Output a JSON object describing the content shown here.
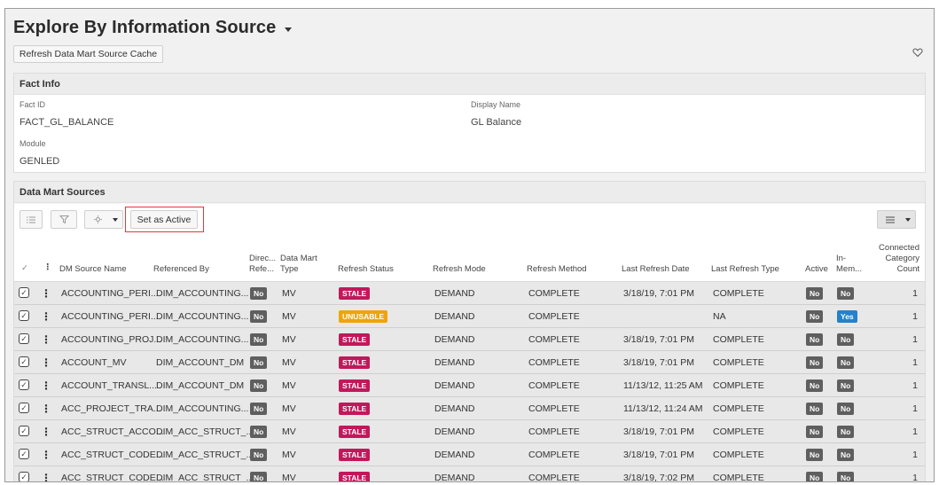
{
  "header": {
    "title": "Explore By Information Source",
    "refresh_button": "Refresh Data Mart Source Cache"
  },
  "fact_info": {
    "heading": "Fact Info",
    "fact_id_label": "Fact ID",
    "fact_id_value": "FACT_GL_BALANCE",
    "display_name_label": "Display Name",
    "display_name_value": "GL Balance",
    "module_label": "Module",
    "module_value": "GENLED"
  },
  "data_mart_sources": {
    "heading": "Data Mart Sources",
    "set_active_button": "Set as Active",
    "columns": {
      "dm_source_name": "DM Source Name",
      "referenced_by": "Referenced By",
      "direct_ref_1": "Direc...",
      "direct_ref_2": "Refe...",
      "dm_type_1": "Data Mart",
      "dm_type_2": "Type",
      "refresh_status": "Refresh Status",
      "refresh_mode": "Refresh Mode",
      "refresh_method": "Refresh Method",
      "last_refresh_date": "Last Refresh Date",
      "last_refresh_type": "Last Refresh Type",
      "active": "Active",
      "in_mem_1": "In-",
      "in_mem_2": "Mem...",
      "conn_1": "Connected",
      "conn_2": "Category",
      "conn_3": "Count"
    },
    "rows": [
      {
        "name": "ACCOUNTING_PERI...",
        "ref": "DIM_ACCOUNTING...",
        "direct": "No",
        "type": "MV",
        "status": "STALE",
        "mode": "DEMAND",
        "method": "COMPLETE",
        "date": "3/18/19, 7:01 PM",
        "ltype": "COMPLETE",
        "active": "No",
        "inmem": "No",
        "count": "1"
      },
      {
        "name": "ACCOUNTING_PERI...",
        "ref": "DIM_ACCOUNTING...",
        "direct": "No",
        "type": "MV",
        "status": "UNUSABLE",
        "mode": "DEMAND",
        "method": "COMPLETE",
        "date": "",
        "ltype": "NA",
        "active": "No",
        "inmem": "Yes",
        "count": "1"
      },
      {
        "name": "ACCOUNTING_PROJ...",
        "ref": "DIM_ACCOUNTING...",
        "direct": "No",
        "type": "MV",
        "status": "STALE",
        "mode": "DEMAND",
        "method": "COMPLETE",
        "date": "3/18/19, 7:01 PM",
        "ltype": "COMPLETE",
        "active": "No",
        "inmem": "No",
        "count": "1"
      },
      {
        "name": "ACCOUNT_MV",
        "ref": "DIM_ACCOUNT_DM",
        "direct": "No",
        "type": "MV",
        "status": "STALE",
        "mode": "DEMAND",
        "method": "COMPLETE",
        "date": "3/18/19, 7:01 PM",
        "ltype": "COMPLETE",
        "active": "No",
        "inmem": "No",
        "count": "1"
      },
      {
        "name": "ACCOUNT_TRANSL...",
        "ref": "DIM_ACCOUNT_DM",
        "direct": "No",
        "type": "MV",
        "status": "STALE",
        "mode": "DEMAND",
        "method": "COMPLETE",
        "date": "11/13/12, 11:25 AM",
        "ltype": "COMPLETE",
        "active": "No",
        "inmem": "No",
        "count": "1"
      },
      {
        "name": "ACC_PROJECT_TRA...",
        "ref": "DIM_ACCOUNTING...",
        "direct": "No",
        "type": "MV",
        "status": "STALE",
        "mode": "DEMAND",
        "method": "COMPLETE",
        "date": "11/13/12, 11:24 AM",
        "ltype": "COMPLETE",
        "active": "No",
        "inmem": "No",
        "count": "1"
      },
      {
        "name": "ACC_STRUCT_ACCO...",
        "ref": "DIM_ACC_STRUCT_...",
        "direct": "No",
        "type": "MV",
        "status": "STALE",
        "mode": "DEMAND",
        "method": "COMPLETE",
        "date": "3/18/19, 7:01 PM",
        "ltype": "COMPLETE",
        "active": "No",
        "inmem": "No",
        "count": "1"
      },
      {
        "name": "ACC_STRUCT_CODE...",
        "ref": "DIM_ACC_STRUCT_...",
        "direct": "No",
        "type": "MV",
        "status": "STALE",
        "mode": "DEMAND",
        "method": "COMPLETE",
        "date": "3/18/19, 7:01 PM",
        "ltype": "COMPLETE",
        "active": "No",
        "inmem": "No",
        "count": "1"
      },
      {
        "name": "ACC_STRUCT_CODE...",
        "ref": "DIM_ACC_STRUCT_...",
        "direct": "No",
        "type": "MV",
        "status": "STALE",
        "mode": "DEMAND",
        "method": "COMPLETE",
        "date": "3/18/19, 7:02 PM",
        "ltype": "COMPLETE",
        "active": "No",
        "inmem": "No",
        "count": "1"
      }
    ]
  },
  "icons": {
    "title_dropdown": "chevron-down-icon",
    "favorite": "heart-icon",
    "list": "list-icon",
    "filter": "filter-icon",
    "settings": "settings-icon",
    "view": "table-view-icon"
  },
  "colors": {
    "stale": "#c2185b",
    "unusable": "#f0a30a",
    "yes": "#2481cc",
    "no": "#5f5f5f",
    "highlight": "#e03a3a"
  }
}
